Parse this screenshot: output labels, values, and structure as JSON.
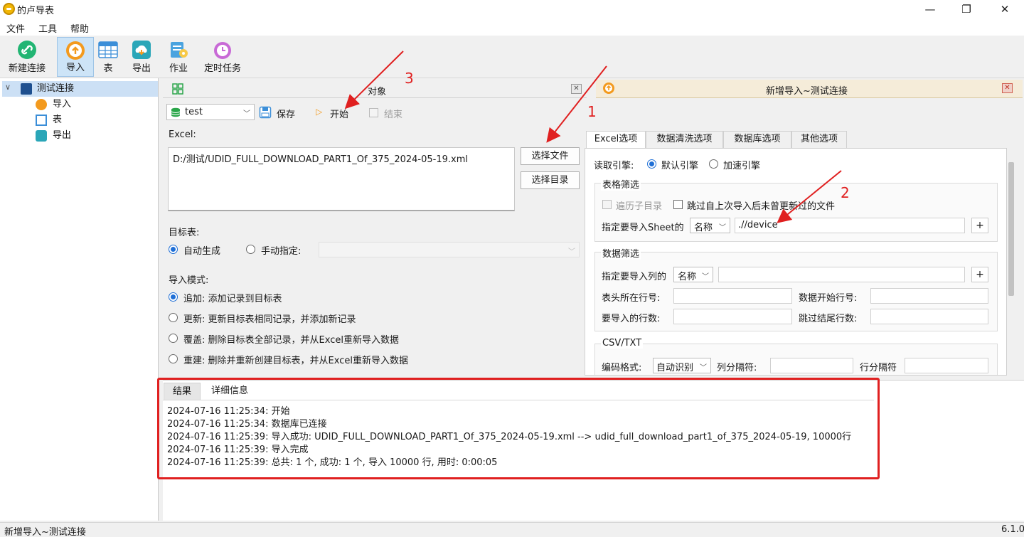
{
  "window": {
    "title": "的卢导表",
    "minimize": "—",
    "maximize": "❐",
    "close": "✕"
  },
  "menu": [
    "文件",
    "工具",
    "帮助"
  ],
  "toolbar": {
    "new_connection": "新建连接",
    "import": "导入",
    "table": "表",
    "export": "导出",
    "job": "作业",
    "scheduled_task": "定时任务"
  },
  "tree": {
    "root": "测试连接",
    "children": [
      "导入",
      "表",
      "导出"
    ]
  },
  "object_panel": {
    "title": "对象",
    "db_select": "test",
    "save": "保存",
    "start": "开始",
    "stop": "结束",
    "excel_label": "Excel:",
    "excel_path": "D:/测试/UDID_FULL_DOWNLOAD_PART1_Of_375_2024-05-19.xml",
    "choose_file": "选择文件",
    "choose_dir": "选择目录",
    "target_label": "目标表:",
    "auto_generate": "自动生成",
    "manual_specify": "手动指定:",
    "mode_label": "导入模式:",
    "modes": [
      {
        "name": "追加",
        "desc": "添加记录到目标表"
      },
      {
        "name": "更新",
        "desc": "更新目标表相同记录，并添加新记录"
      },
      {
        "name": "覆盖",
        "desc": "删除目标表全部记录，并从Excel重新导入数据"
      },
      {
        "name": "重建",
        "desc": "删除并重新创建目标表，并从Excel重新导入数据"
      }
    ]
  },
  "right_panel": {
    "title": "新增导入~测试连接",
    "tabs": [
      "Excel选项",
      "数据清洗选项",
      "数据库选项",
      "其他选项"
    ],
    "engine_label": "读取引擎:",
    "engine_default": "默认引擎",
    "engine_fast": "加速引擎",
    "sheet_filter": "表格筛选",
    "traverse_subdir": "遍历子目录",
    "skip_unchanged": "跳过自上次导入后未曾更新过的文件",
    "sheet_label": "指定要导入Sheet的",
    "sheet_mode": "名称",
    "sheet_value": ".//device",
    "plus": "+",
    "data_filter": "数据筛选",
    "columns_label": "指定要导入列的",
    "columns_mode": "名称",
    "header_row": "表头所在行号:",
    "data_start_row": "数据开始行号:",
    "rows_to_import": "要导入的行数:",
    "skip_tail_rows": "跳过结尾行数:",
    "csv_title": "CSV/TXT",
    "encoding_label": "编码格式:",
    "encoding_value": "自动识别",
    "col_sep": "列分隔符:",
    "row_sep": "行分隔符"
  },
  "bottom": {
    "tabs": [
      "结果",
      "详细信息"
    ],
    "log": [
      "2024-07-16 11:25:34: 开始",
      "2024-07-16 11:25:34: 数据库已连接",
      "2024-07-16 11:25:39: 导入成功: UDID_FULL_DOWNLOAD_PART1_Of_375_2024-05-19.xml --> udid_full_download_part1_of_375_2024-05-19, 10000行",
      "2024-07-16 11:25:39: 导入完成",
      "2024-07-16 11:25:39: 总共: 1 个, 成功: 1 个, 导入 10000 行, 用时: 0:00:05"
    ]
  },
  "annotations": [
    "1",
    "2",
    "3"
  ],
  "status": {
    "left": "新增导入~测试连接",
    "version": "6.1.0"
  },
  "colors": {
    "accent": "#1f6fd6",
    "annotation": "#e02020"
  }
}
